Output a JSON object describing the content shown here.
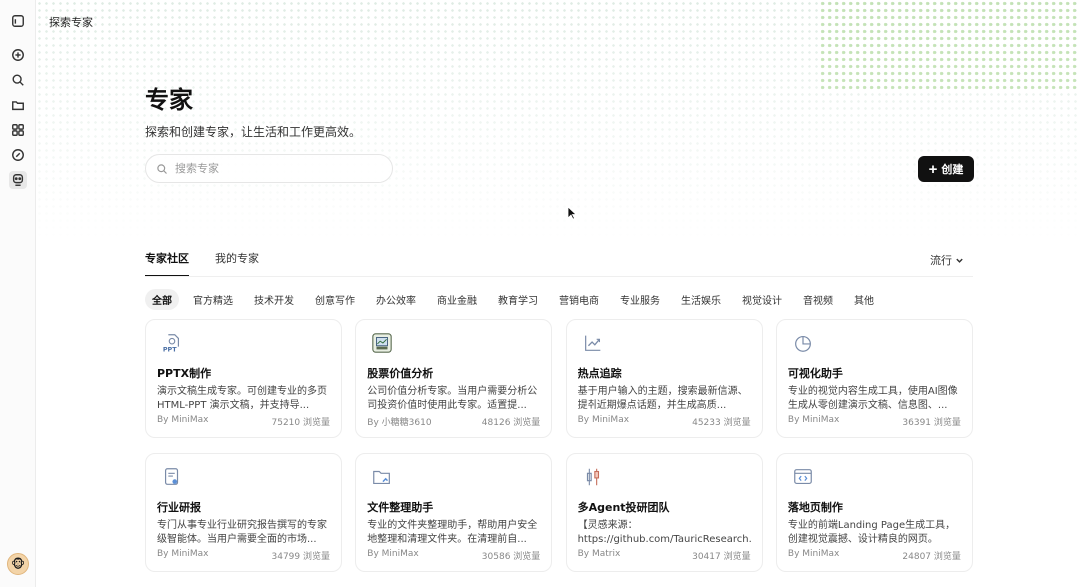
{
  "header": {
    "title": "探索专家"
  },
  "page": {
    "title": "专家",
    "subtitle": "探索和创建专家，让生活和工作更高效。"
  },
  "search": {
    "placeholder": "搜索专家"
  },
  "create_button": {
    "label": "创建",
    "icon": "plus-icon"
  },
  "sidebar": {
    "icons": [
      "layout-icon",
      "new-chat-icon",
      "search-icon",
      "folder-icon",
      "apps-icon",
      "edit-icon",
      "expert-icon"
    ],
    "avatar": "🐵"
  },
  "tabs": [
    {
      "label": "专家社区",
      "active": true
    },
    {
      "label": "我的专家",
      "active": false
    }
  ],
  "sort": {
    "label": "流行"
  },
  "categories": [
    "全部",
    "官方精选",
    "技术开发",
    "创意写作",
    "办公效率",
    "商业金融",
    "教育学习",
    "营销电商",
    "专业服务",
    "生活娱乐",
    "视觉设计",
    "音视频",
    "其他"
  ],
  "active_category": "全部",
  "cards": [
    {
      "icon": "ppt-icon",
      "title": "PPTX制作",
      "desc": "演示文稿生成专家。可创建专业的多页 HTML-PPT 演示文稿，并支持导...",
      "author": "By MiniMax",
      "views": "75210 浏览量"
    },
    {
      "icon": "stock-icon",
      "title": "股票价值分析",
      "desc": "公司价值分析专家。当用户需要分析公司投资价值时使用此专家。适置提...",
      "author": "By 小糖糖3610",
      "views": "48126 浏览量"
    },
    {
      "icon": "trend-icon",
      "title": "热点追踪",
      "desc": "基于用户输入的主题，搜索最新信源、提취近期爆点话题，并生成高质...",
      "author": "By MiniMax",
      "views": "45233 浏览量"
    },
    {
      "icon": "pie-chart-icon",
      "title": "可视化助手",
      "desc": "专业的视觉内容生成工具，使用AI图像生成从零创建演示文稿、信息图、...",
      "author": "By MiniMax",
      "views": "36391 浏览量"
    },
    {
      "icon": "report-icon",
      "title": "行业研报",
      "desc": "专门从事专业行业研究报告撰写的专家级智能体。当用户需要全面的市场...",
      "author": "By MiniMax",
      "views": "34799 浏览量"
    },
    {
      "icon": "folder-clean-icon",
      "title": "文件整理助手",
      "desc": "专业的文件夹整理助手，帮助用户安全地整理和清理文件夹。在清理前自...",
      "author": "By MiniMax",
      "views": "30586 浏览量"
    },
    {
      "icon": "candlestick-icon",
      "title": "多Agent投研团队",
      "desc": "【灵感来源：https://github.com/TauricResearch...",
      "author": "By Matrix",
      "views": "30417 浏览量"
    },
    {
      "icon": "landing-page-icon",
      "title": "落地页制作",
      "desc": "专业的前端Landing Page生成工具，创建视觉震撼、设计精良的网页。",
      "author": "By MiniMax",
      "views": "24807 浏览量"
    }
  ]
}
